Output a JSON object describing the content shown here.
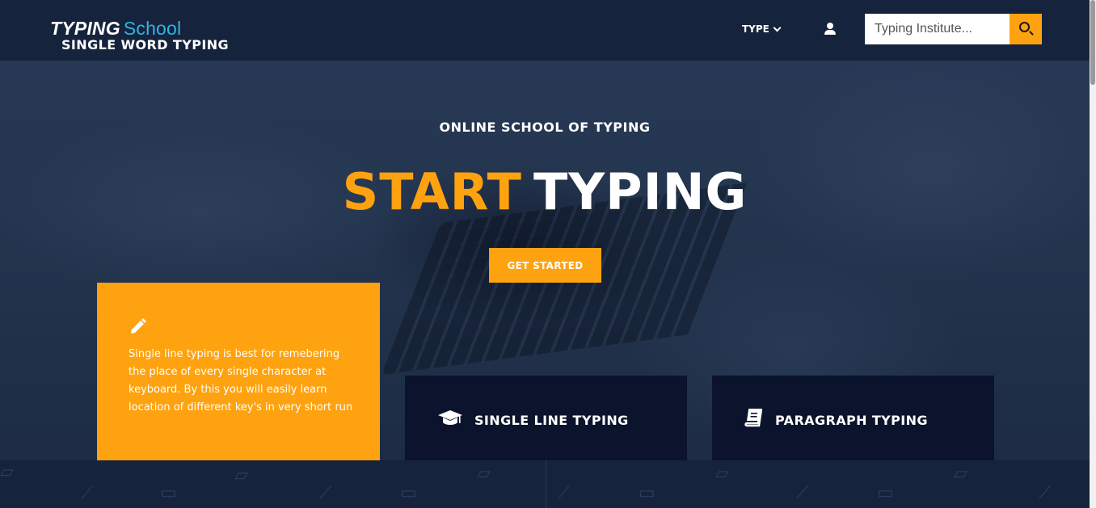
{
  "header": {
    "logo_bold": "TYPING",
    "logo_light": "School",
    "nav_type_label": "TYPE",
    "search_placeholder": "Typing Institute..."
  },
  "hero": {
    "subtitle": "ONLINE SCHOOL OF TYPING",
    "title_orange": "START",
    "title_white": "TYPING",
    "cta_label": "GET STARTED"
  },
  "cards": [
    {
      "icon": "pencil-icon",
      "title": "SINGLE WORD TYPING",
      "description": "Single line typing is best for remebering the place of every single character at keyboard. By this you will easily learn location of different key's in very short run"
    },
    {
      "icon": "graduation-cap-icon",
      "title": "SINGLE LINE TYPING"
    },
    {
      "icon": "book-icon",
      "title": "PARAGRAPH TYPING"
    }
  ],
  "colors": {
    "accent": "#ffa20f",
    "header_bg": "#16233c",
    "card_dark": "#0c132c",
    "logo_blue": "#31b4e6"
  }
}
